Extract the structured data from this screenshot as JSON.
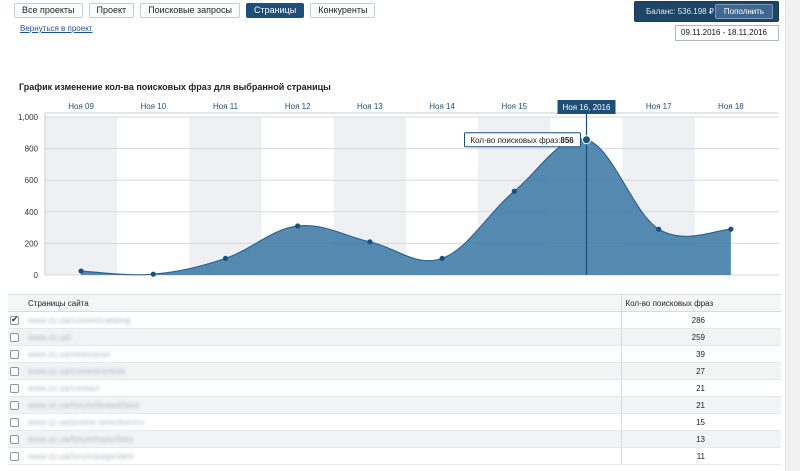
{
  "nav": {
    "tabs": [
      {
        "label": "Все проекты",
        "active": false
      },
      {
        "label": "Проект",
        "active": false
      },
      {
        "label": "Поисковые запросы",
        "active": false
      },
      {
        "label": "Страницы",
        "active": true
      },
      {
        "label": "Конкуренты",
        "active": false
      }
    ],
    "back_link": "Вернуться в проект"
  },
  "balance": {
    "text": "Баланс: 536.198 ₽",
    "topup_label": "Пополнить"
  },
  "date_range": "09.11.2016 - 18.11.2016",
  "chart_section": {
    "title": "График изменение кол-ва поисковых фраз для выбранной страницы"
  },
  "chart_data": {
    "type": "area",
    "categories": [
      "Ноя 09",
      "Ноя 10",
      "Ноя 11",
      "Ноя 12",
      "Ноя 13",
      "Ноя 14",
      "Ноя 15",
      "Ноя 16",
      "Ноя 17",
      "Ноя 18"
    ],
    "values": [
      25,
      5,
      105,
      310,
      210,
      105,
      530,
      856,
      290,
      290
    ],
    "y_ticks": [
      "0",
      "200",
      "400",
      "600",
      "800",
      "1,000"
    ],
    "ylim": [
      0,
      1000
    ],
    "highlighted_index": 7,
    "highlight_label": "Ноя 16, 2016",
    "tooltip": {
      "label": "Кол-во поисковых фраз:",
      "value": "856"
    },
    "colors": {
      "area": "#3f7aa6",
      "line": "#2d6591",
      "point": "#1b4f7c",
      "band": "#eef0f3",
      "crosshair": "#1b4f7c"
    }
  },
  "table": {
    "headers": {
      "pages": "Страницы сайта",
      "count": "Кол-во поисковых фраз"
    },
    "rows": [
      {
        "checked": true,
        "url": "www.zz.ua/content/catalog",
        "count": "286"
      },
      {
        "checked": false,
        "url": "www.zz.ua/",
        "count": "259"
      },
      {
        "checked": false,
        "url": "www.zz.ua/news/post",
        "count": "39"
      },
      {
        "checked": false,
        "url": "www.zz.ua/content/article",
        "count": "27"
      },
      {
        "checked": false,
        "url": "www.zz.ua/contact",
        "count": "21"
      },
      {
        "checked": false,
        "url": "www.zz.ua/forum/thread/item",
        "count": "21"
      },
      {
        "checked": false,
        "url": "www.zz.ua/promo-selection/cu",
        "count": "15"
      },
      {
        "checked": false,
        "url": "www.zz.ua/forum/topic/item",
        "count": "13"
      },
      {
        "checked": false,
        "url": "www.zz.ua/forum/page/item",
        "count": "11"
      }
    ]
  }
}
